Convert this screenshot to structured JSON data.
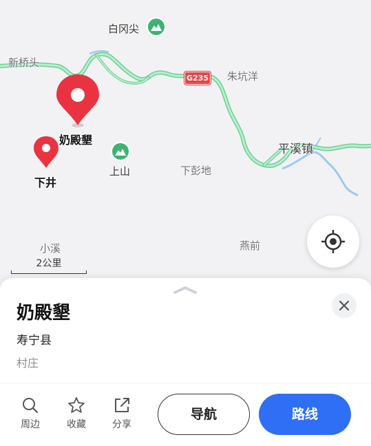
{
  "colors": {
    "pin_red": "#ea3341",
    "road_green": "#8fdcae",
    "road_outline": "#6ccf96",
    "river_blue": "#9dc9ee",
    "shield_red": "#e0484a",
    "primary_blue": "#2f6ff6",
    "poi_green": "#3cb371"
  },
  "map": {
    "labels": {
      "baigangjian": "白冈尖",
      "xinqiaotou": "新桥头",
      "zhukengyang": "朱坑洋",
      "naidianao": "奶殿墾",
      "pingxizhen": "平溪镇",
      "shangshan": "上山",
      "xiapengdi": "下彭地",
      "xiajing": "下井",
      "xiaoxi": "小溪",
      "yanqian": "燕前"
    },
    "road_shield": "G235",
    "scale_label": "2公里",
    "icons": {
      "poi": "mountain-icon",
      "selected_pin": "map-pin-icon",
      "secondary_pin": "map-pin-icon",
      "locate": "locate-crosshair-icon"
    }
  },
  "sheet": {
    "title": "奶殿墾",
    "subtitle": "寿宁县",
    "category": "村庄",
    "actions": [
      {
        "label": "周边",
        "icon": "search-icon"
      },
      {
        "label": "收藏",
        "icon": "star-icon"
      },
      {
        "label": "分享",
        "icon": "share-icon"
      }
    ],
    "navigate_label": "导航",
    "route_label": "路线",
    "close_icon": "close-icon",
    "handle_icon": "chevron-up-icon"
  }
}
